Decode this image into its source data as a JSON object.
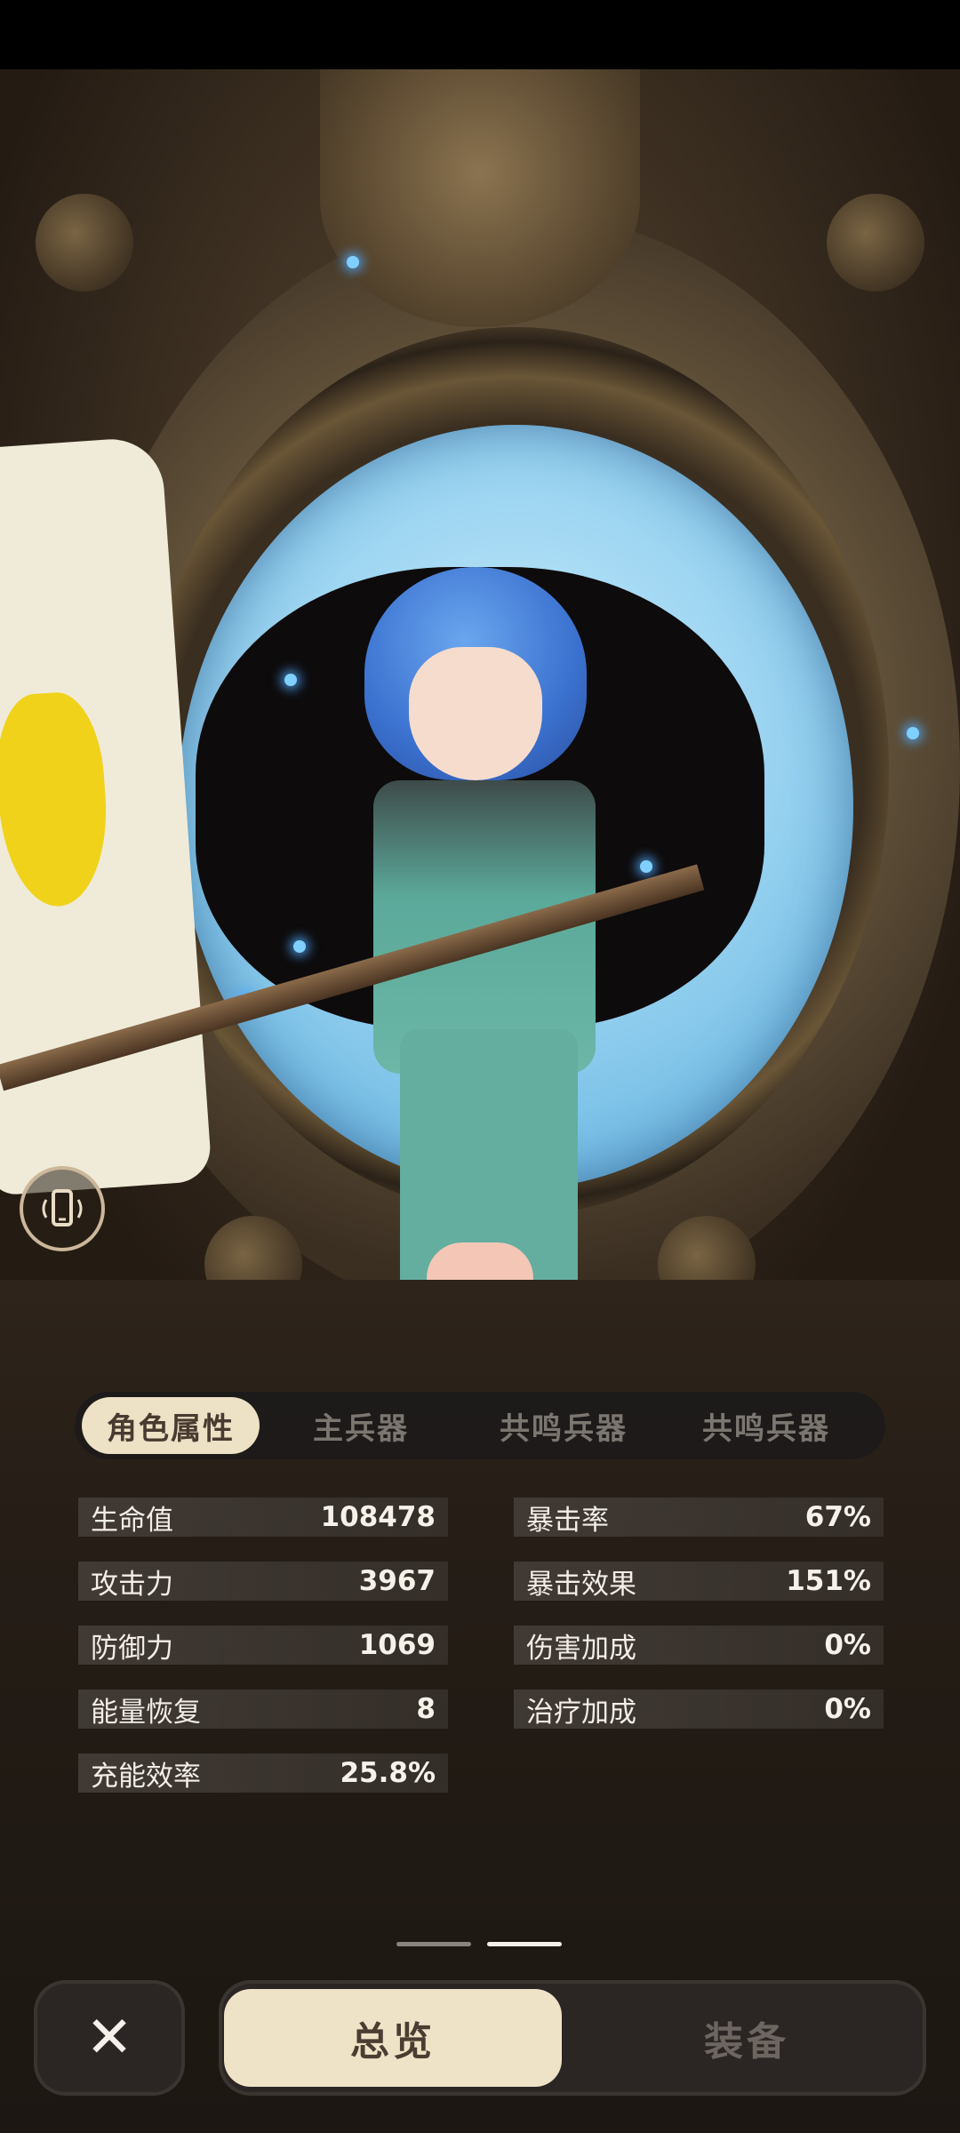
{
  "tabs": [
    {
      "label": "角色属性",
      "active": true
    },
    {
      "label": "主兵器",
      "active": false
    },
    {
      "label": "共鸣兵器",
      "active": false
    },
    {
      "label": "共鸣兵器",
      "active": false
    }
  ],
  "stats": {
    "left": [
      {
        "label": "生命值",
        "value": "108478"
      },
      {
        "label": "攻击力",
        "value": "3967"
      },
      {
        "label": "防御力",
        "value": "1069"
      },
      {
        "label": "能量恢复",
        "value": "8"
      },
      {
        "label": "充能效率",
        "value": "25.8%"
      }
    ],
    "right": [
      {
        "label": "暴击率",
        "value": "67%"
      },
      {
        "label": "暴击效果",
        "value": "151%"
      },
      {
        "label": "伤害加成",
        "value": "0%"
      },
      {
        "label": "治疗加成",
        "value": "0%"
      }
    ]
  },
  "pager": {
    "count": 2,
    "active_index": 1
  },
  "bottom": {
    "close_icon": "close-icon",
    "overview_label": "总览",
    "equip_label": "装备"
  },
  "icons": {
    "gyro": "phone-gyro-icon"
  },
  "colors": {
    "portal": "#9fd6f2",
    "active_tab_bg": "#ede1c6",
    "panel_bg": "#2b2624"
  }
}
